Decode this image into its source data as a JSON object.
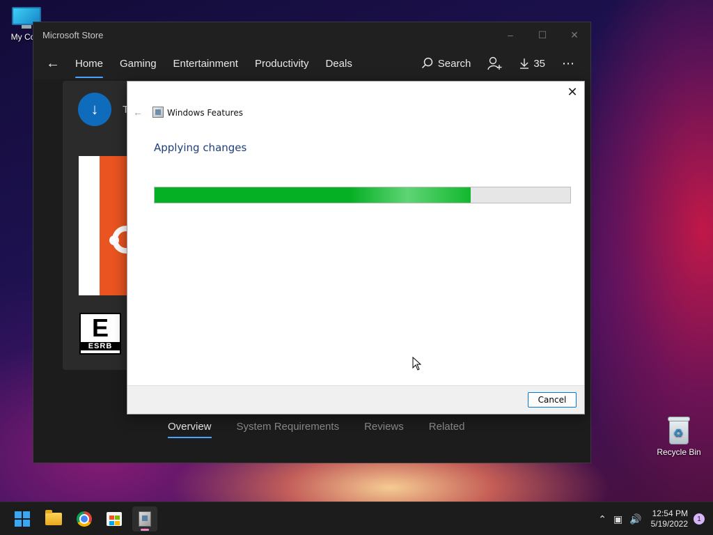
{
  "desktop": {
    "my_computer_label": "My Com",
    "recycle_bin_label": "Recycle Bin"
  },
  "store": {
    "title": "Microsoft Store",
    "nav_tabs": [
      "Home",
      "Gaming",
      "Entertainment",
      "Productivity",
      "Deals"
    ],
    "active_tab": "Home",
    "search_label": "Search",
    "downloads_count": "35",
    "app_initial": "T",
    "esrb_letter": "E",
    "esrb_brand": "ESRB",
    "bottom_tabs": [
      "Overview",
      "System Requirements",
      "Reviews",
      "Related"
    ],
    "active_bottom_tab": "Overview",
    "accent_color": "#4aa3ff"
  },
  "dialog": {
    "title": "Windows Features",
    "heading": "Applying changes",
    "progress_fraction": 0.76,
    "progress_color": "#06b025",
    "cancel_label": "Cancel"
  },
  "taskbar": {
    "apps": [
      "start-icon",
      "file-explorer-icon",
      "chrome-icon",
      "microsoft-store-icon",
      "windows-features-icon"
    ],
    "time": "12:54 PM",
    "date": "5/19/2022",
    "notification_count": "1"
  }
}
